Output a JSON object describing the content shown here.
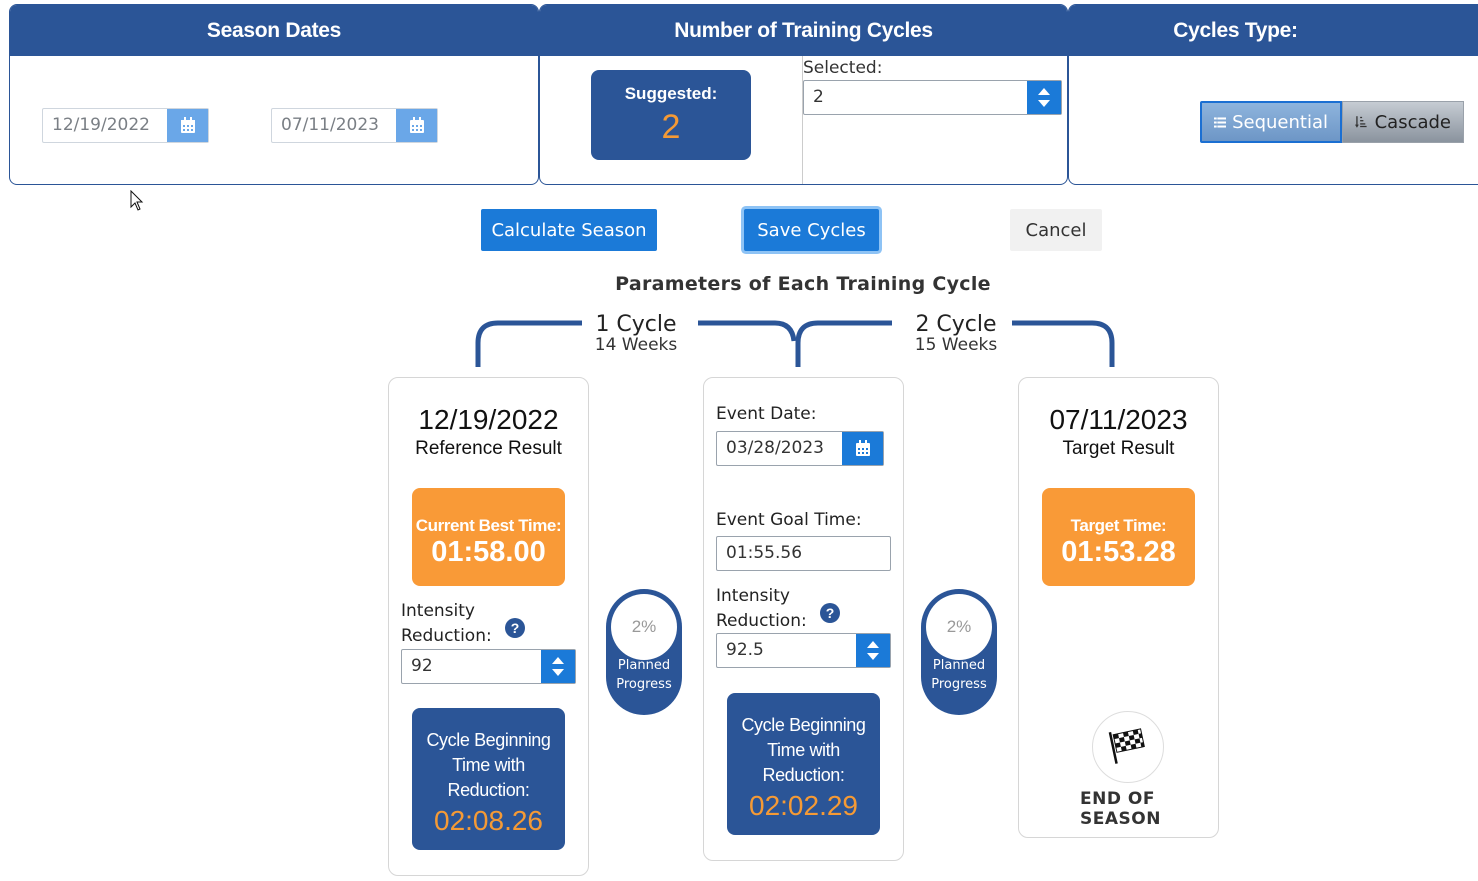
{
  "panels": {
    "season_dates": {
      "title": "Season Dates",
      "start": "12/19/2022",
      "end": "07/11/2023"
    },
    "training_cycles": {
      "title": "Number of Training Cycles",
      "suggested_label": "Suggested:",
      "suggested_value": "2",
      "selected_label": "Selected:",
      "selected_value": "2"
    },
    "cycles_type": {
      "title": "Cycles Type:",
      "options": [
        "Sequential",
        "Cascade"
      ],
      "active": "Sequential"
    }
  },
  "actions": {
    "calculate": "Calculate Season",
    "save": "Save Cycles",
    "cancel": "Cancel"
  },
  "section_title": "Parameters of Each Training Cycle",
  "cycles": [
    {
      "title": "1 Cycle",
      "weeks": "14 Weeks"
    },
    {
      "title": "2 Cycle",
      "weeks": "15 Weeks"
    }
  ],
  "start_card": {
    "date": "12/19/2022",
    "label": "Reference Result",
    "best_label": "Current Best Time:",
    "best_value": "01:58.00",
    "intensity_label_1": "Intensity",
    "intensity_label_2": "Reduction:",
    "intensity_value": "92",
    "beginning_label": "Cycle Beginning Time with Reduction:",
    "beginning_value": "02:08.26"
  },
  "mid_card": {
    "event_date_label": "Event Date:",
    "event_date": "03/28/2023",
    "goal_label": "Event Goal Time:",
    "goal_value": "01:55.56",
    "intensity_label_1": "Intensity",
    "intensity_label_2": "Reduction:",
    "intensity_value": "92.5",
    "beginning_label": "Cycle Beginning Time with Reduction:",
    "beginning_value": "02:02.29"
  },
  "end_card": {
    "date": "07/11/2023",
    "label": "Target Result",
    "target_label": "Target Time:",
    "target_value": "01:53.28",
    "end_label": "END OF SEASON"
  },
  "progress": [
    {
      "percent": "2%",
      "label_1": "Planned",
      "label_2": "Progress"
    },
    {
      "percent": "2%",
      "label_1": "Planned",
      "label_2": "Progress"
    }
  ],
  "help_symbol": "?",
  "icons": [
    "calendar-icon",
    "list-icon",
    "sort-icon",
    "checkered-flag-icon",
    "mouse-cursor-icon"
  ],
  "colors": {
    "primary": "#2b5597",
    "accent_orange": "#f99a37",
    "button_blue": "#1b7ad8"
  }
}
